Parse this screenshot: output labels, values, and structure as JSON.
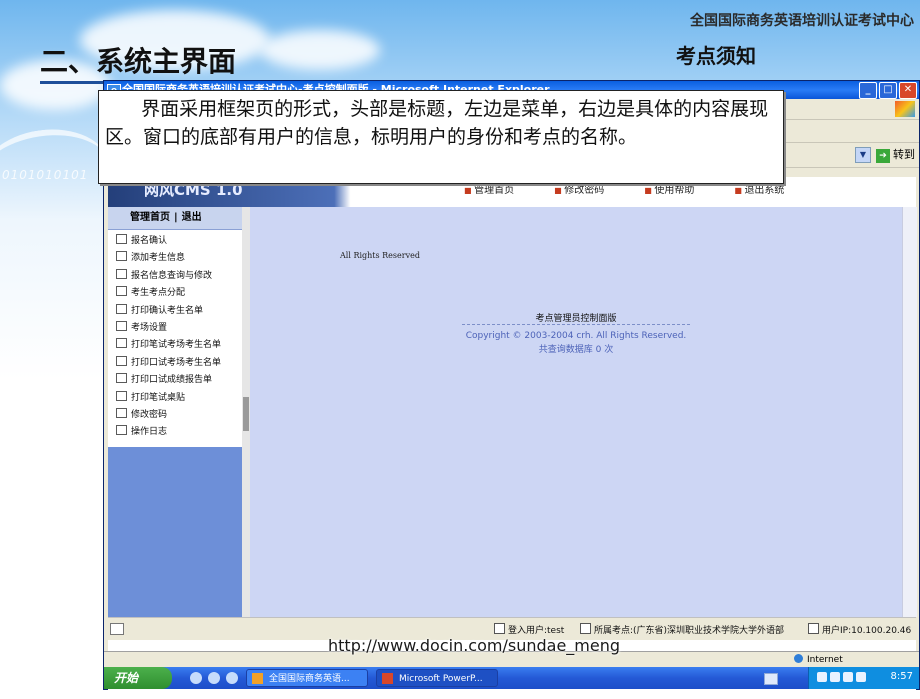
{
  "slide": {
    "org": "全国国际商务英语培训认证考试中心",
    "title": "二、系统主界面",
    "subtitle": "考点须知",
    "deco_text": "0101010101"
  },
  "window": {
    "title": "全国国际商务英语培训认证考试中心-考点控制面版 - Microsoft Internet Explorer",
    "go_label": "转到",
    "status_zone": "Internet"
  },
  "cms": {
    "logo": "网风CMS 1.0",
    "topnav": [
      "管理首页",
      "修改密码",
      "使用帮助",
      "退出系统"
    ],
    "left_top": {
      "home": "管理首页",
      "sep": "|",
      "logout": "退出"
    },
    "menu": [
      "报名确认",
      "添加考生信息",
      "报名信息查询与修改",
      "考生考点分配",
      "打印确认考生名单",
      "考场设置",
      "打印笔试考场考生名单",
      "打印口试考场考生名单",
      "打印口试成绩报告单",
      "打印笔试桌贴",
      "修改密码",
      "操作日志"
    ],
    "rights": "All Rights Reserved",
    "panel_title": "考点管理员控制面版",
    "copyright": "Copyright © 2003-2004 crh. All Rights Reserved.",
    "queries": "共查询数据库 0 次",
    "status": {
      "login_user": "登入用户:test",
      "site": "所属考点:(广东省)深圳职业技术学院大学外语部",
      "user_ip": "用户IP:10.100.20.46"
    }
  },
  "taskbar": {
    "start": "开始",
    "tasks": [
      "全国国际商务英语...",
      "Microsoft PowerP..."
    ],
    "clock": "8:57"
  },
  "callout": {
    "text": "界面采用框架页的形式，头部是标题，左边是菜单，右边是具体的内容展现区。窗口的底部有用户的信息，标明用户的身份和考点的名称。"
  },
  "watermark": "http://www.docin.com/sundae_meng"
}
